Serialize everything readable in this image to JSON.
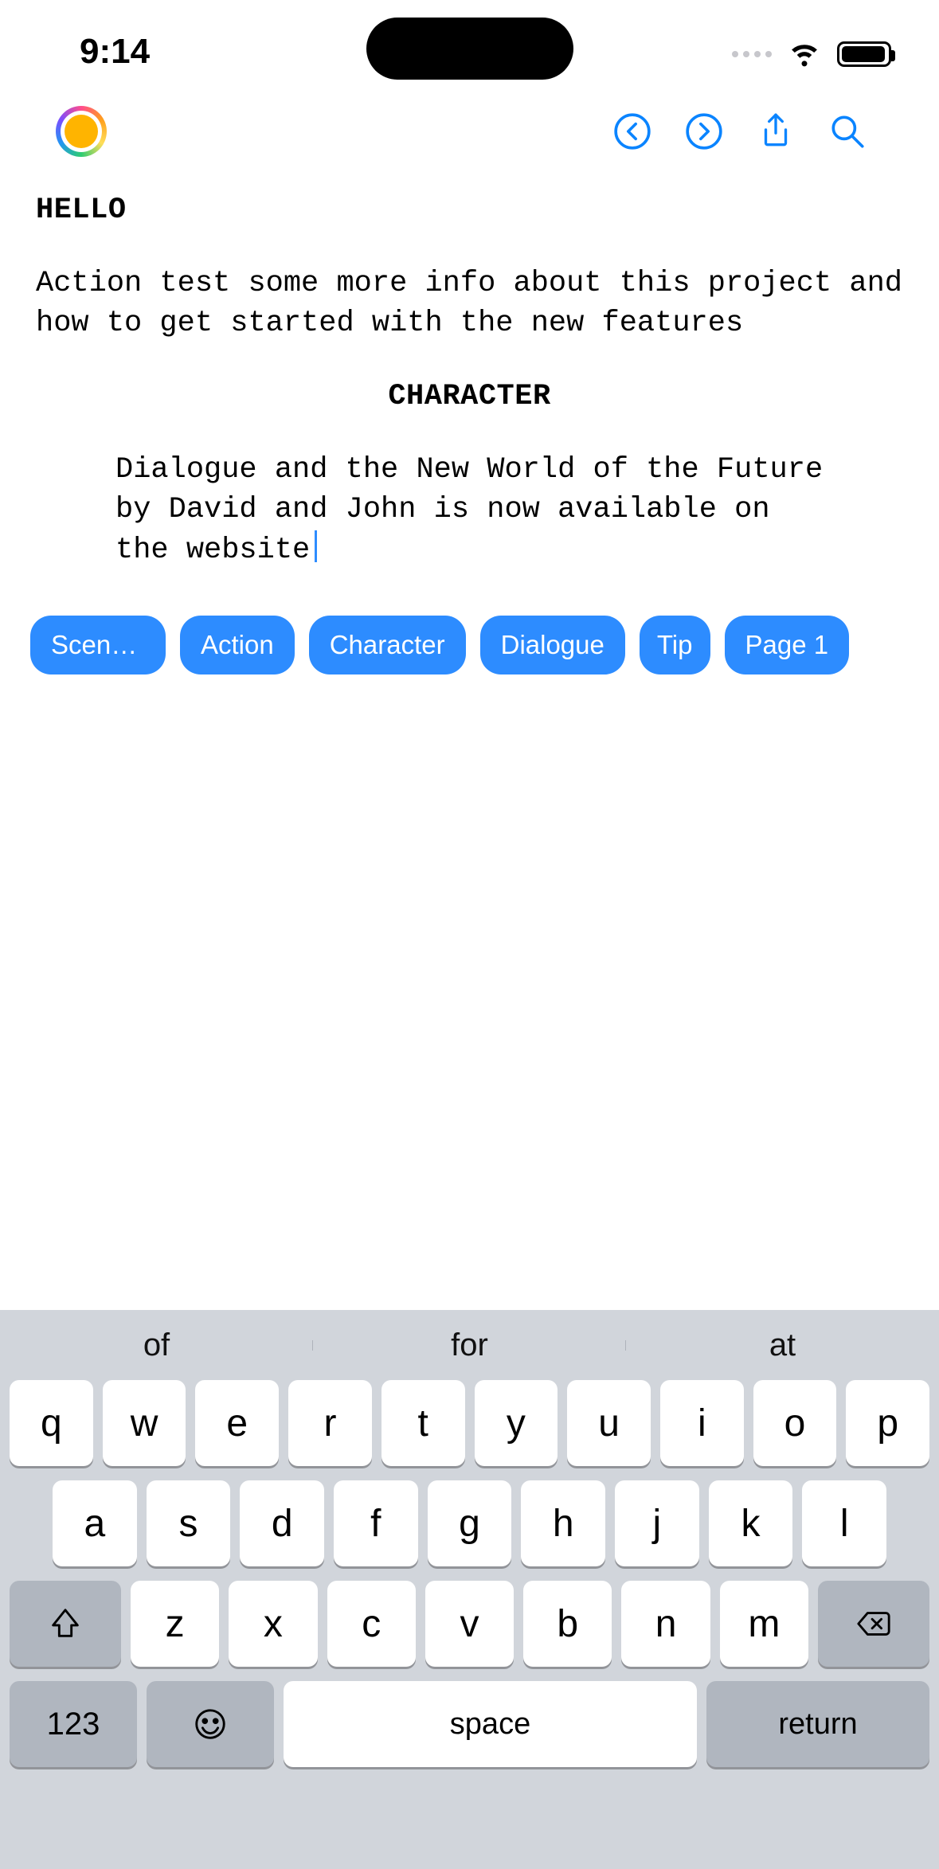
{
  "status": {
    "time": "9:14"
  },
  "toolbar": {
    "undo": "undo",
    "redo": "redo",
    "share": "share",
    "search": "search"
  },
  "doc": {
    "scene_heading": "HELLO",
    "action": "Action test some more info about this project and how to get started with the new features",
    "character": "CHARACTER",
    "dialogue": "Dialogue and the New World of the Future by David and John is now available on the website"
  },
  "chips": {
    "scene": "Scene H...",
    "action": "Action",
    "character": "Character",
    "dialogue": "Dialogue",
    "tip": "Tip",
    "page": "Page 1"
  },
  "keyboard": {
    "suggestions": [
      "of",
      "for",
      "at"
    ],
    "row1": [
      "q",
      "w",
      "e",
      "r",
      "t",
      "y",
      "u",
      "i",
      "o",
      "p"
    ],
    "row2": [
      "a",
      "s",
      "d",
      "f",
      "g",
      "h",
      "j",
      "k",
      "l"
    ],
    "row3": [
      "z",
      "x",
      "c",
      "v",
      "b",
      "n",
      "m"
    ],
    "num_label": "123",
    "space_label": "space",
    "return_label": "return"
  }
}
